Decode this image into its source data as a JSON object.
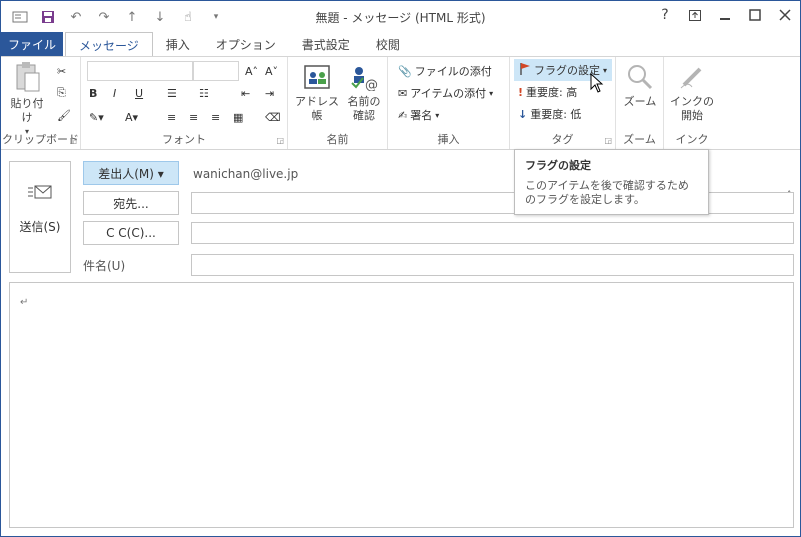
{
  "window": {
    "title": "無題 - メッセージ (HTML 形式)"
  },
  "quick_access": {
    "icons": [
      "outlook-icon",
      "save-icon",
      "undo-icon",
      "redo-icon",
      "up-icon",
      "down-icon",
      "touch-mode-icon",
      "customize-icon"
    ]
  },
  "window_controls": {
    "help": "?",
    "ribbon_display": "□",
    "minimize": "—",
    "maximize": "□",
    "close": "✕"
  },
  "tabs": [
    {
      "label": "ファイル"
    },
    {
      "label": "メッセージ"
    },
    {
      "label": "挿入"
    },
    {
      "label": "オプション"
    },
    {
      "label": "書式設定"
    },
    {
      "label": "校閲"
    }
  ],
  "ribbon": {
    "clipboard": {
      "label": "クリップボード",
      "paste": "貼り付け"
    },
    "font": {
      "label": "フォント"
    },
    "names": {
      "label": "名前",
      "address_book": "アドレス帳",
      "check_names_1": "名前の",
      "check_names_2": "確認"
    },
    "insert": {
      "label": "挿入",
      "attach_file": "ファイルの添付",
      "attach_item": "アイテムの添付",
      "signature": "署名"
    },
    "tags": {
      "label": "タグ",
      "follow_up": "フラグの設定",
      "high_importance": "重要度: 高",
      "low_importance": "重要度: 低"
    },
    "zoom": {
      "label": "ズーム",
      "zoom_btn": "ズーム"
    },
    "ink": {
      "label": "インク",
      "start_1": "インクの",
      "start_2": "開始"
    }
  },
  "tooltip": {
    "title": "フラグの設定",
    "body": "このアイテムを後で確認するためのフラグを設定します。"
  },
  "compose": {
    "send": "送信(S)",
    "from_button": "差出人(M) ▾",
    "from_value": "wanichan@live.jp",
    "to_button": "宛先...",
    "cc_button": "C C(C)...",
    "subject_label": "件名(U)",
    "body_mark": "↵"
  },
  "colors": {
    "accent": "#2b579a",
    "highlight": "#cde6f7"
  }
}
